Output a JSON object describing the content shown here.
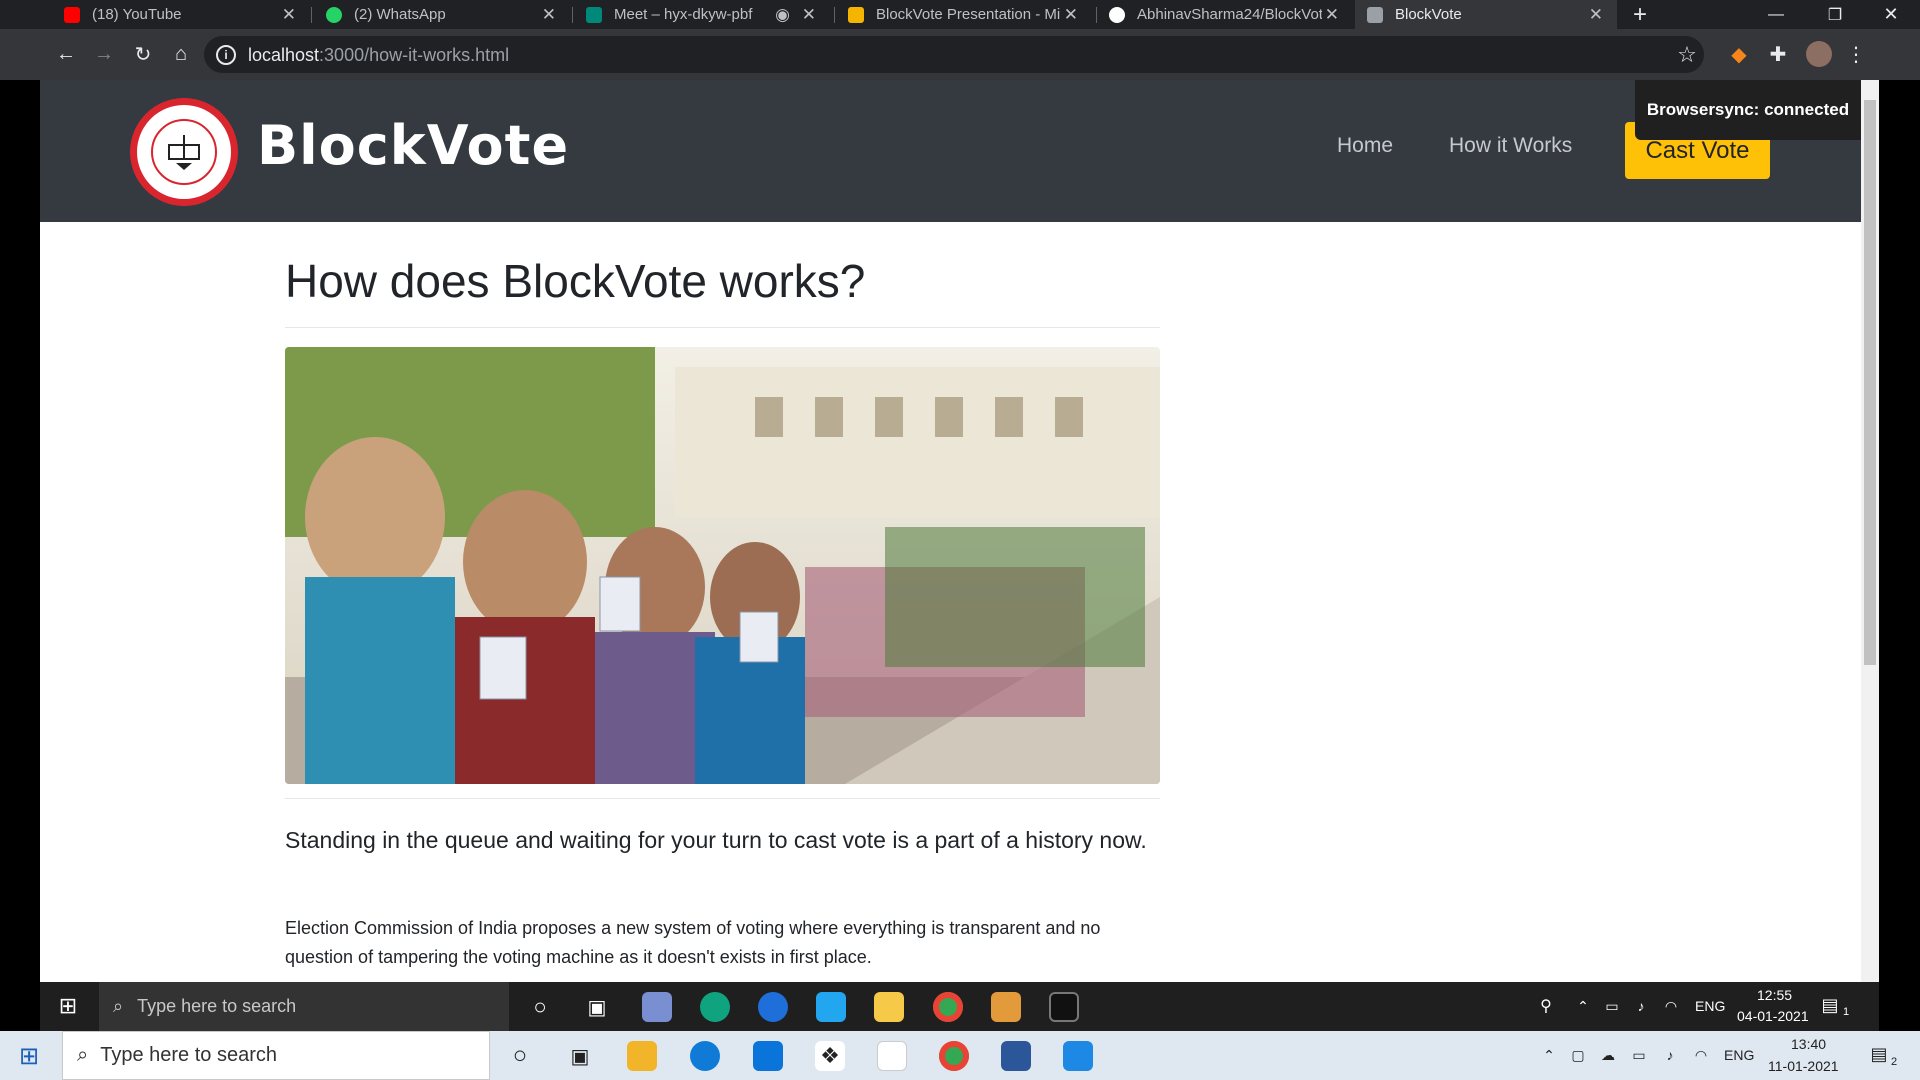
{
  "browser": {
    "tabs": [
      {
        "label": "(18) YouTube",
        "icon": "youtube-icon",
        "color": "#ff0000"
      },
      {
        "label": "(2) WhatsApp",
        "icon": "whatsapp-icon",
        "color": "#25d366"
      },
      {
        "label": "Meet – hyx-dkyw-pbf",
        "icon": "google-meet-icon",
        "color": "#00897b"
      },
      {
        "label": "BlockVote Presentation - Mi",
        "icon": "google-slides-icon",
        "color": "#f4b400"
      },
      {
        "label": "AbhinavSharma24/BlockVote",
        "icon": "github-icon",
        "color": "#ffffff"
      },
      {
        "label": "BlockVote",
        "icon": "page-icon",
        "color": "#9aa0a6"
      }
    ],
    "new_tab": "+",
    "url": {
      "host": "localhost",
      "rest": ":3000/how-it-works.html"
    }
  },
  "page": {
    "brand": "BlockVote",
    "nav": {
      "home": "Home",
      "how": "How it Works",
      "cast": "Cast Vote"
    },
    "toast": "Browsersync: connected",
    "heading": "How does BlockVote works?",
    "lead": "Standing in the queue and waiting for your turn to cast vote is a part of a history now.",
    "body": "Election Commission of India proposes a new system of voting where everything is transparent and no question of tampering the voting machine as it doesn't exists in first place.",
    "colors": {
      "navbar": "#343a40",
      "accent": "#ffc107",
      "seal": "#d9262e"
    }
  },
  "taskbar_inner": {
    "search_placeholder": "Type here to search",
    "lang": "ENG",
    "time": "12:55",
    "date": "04-01-2021",
    "notification_count": "1"
  },
  "taskbar_outer": {
    "search_placeholder": "Type here to search",
    "lang": "ENG",
    "time": "13:40",
    "date": "11-01-2021",
    "notification_count": "2"
  }
}
